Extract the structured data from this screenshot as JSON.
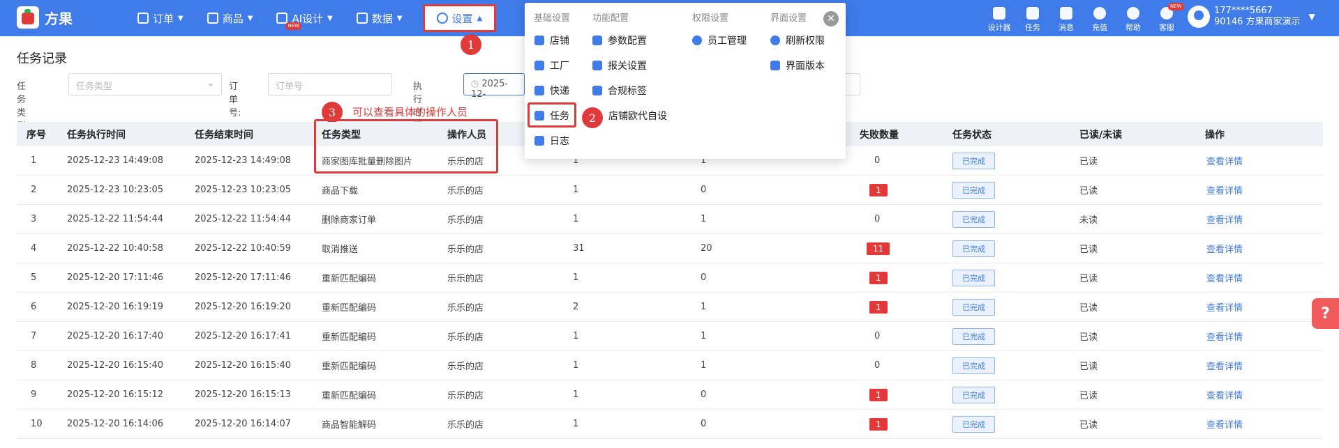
{
  "app": {
    "name": "方果"
  },
  "nav": [
    {
      "label": "订单",
      "icon": "order-icon"
    },
    {
      "label": "商品",
      "icon": "goods-icon"
    },
    {
      "label": "AI设计",
      "icon": "ai-icon",
      "badge": "NEW"
    },
    {
      "label": "数据",
      "icon": "chart-icon"
    },
    {
      "label": "设置",
      "icon": "gear-icon",
      "active": true
    }
  ],
  "tools": [
    {
      "label": "设计器",
      "icon": "designer-icon"
    },
    {
      "label": "任务",
      "icon": "task-icon"
    },
    {
      "label": "消息",
      "icon": "message-icon"
    },
    {
      "label": "充值",
      "icon": "recharge-icon"
    },
    {
      "label": "帮助",
      "icon": "help-icon"
    },
    {
      "label": "客服",
      "icon": "service-icon",
      "badge": "NEW"
    }
  ],
  "user": {
    "phone": "177****5667",
    "account": "90146 方果商家演示"
  },
  "page": {
    "title": "任务记录"
  },
  "filters": {
    "task_type_label": "任务类型:",
    "task_type_placeholder": "任务类型",
    "order_label": "订单号:",
    "order_placeholder": "订单号",
    "time_label": "执行时间:",
    "time_value": "2025-12-"
  },
  "annotations": {
    "n1": "1",
    "n2": "2",
    "n3": "3",
    "n3_text": "可以查看具体的操作人员"
  },
  "dropdown": {
    "headers": [
      "基础设置",
      "功能配置",
      "权限设置",
      "界面设置"
    ],
    "col1": [
      {
        "label": "店铺",
        "icon": "store-icon"
      },
      {
        "label": "工厂",
        "icon": "factory-icon"
      },
      {
        "label": "快递",
        "icon": "express-icon"
      },
      {
        "label": "任务",
        "icon": "task-list-icon"
      },
      {
        "label": "日志",
        "icon": "log-icon"
      }
    ],
    "col2": [
      {
        "label": "参数配置",
        "icon": "params-icon"
      },
      {
        "label": "报关设置",
        "icon": "customs-icon"
      },
      {
        "label": "合规标签",
        "icon": "label-icon"
      },
      {
        "label": "店铺代自设",
        "icon": "",
        "overlap_note": "店铺欧代自设"
      }
    ],
    "col3": [
      {
        "label": "员工管理",
        "icon": "staff-icon"
      }
    ],
    "col4": [
      {
        "label": "刷新权限",
        "icon": "refresh-icon"
      },
      {
        "label": "界面版本",
        "icon": "version-icon"
      }
    ]
  },
  "table": {
    "headers": [
      "序号",
      "任务执行时间",
      "任务结束时间",
      "任务类型",
      "操作人员",
      "失败数量",
      "任务状态",
      "已读/未读",
      "操作"
    ],
    "rows": [
      {
        "no": "1",
        "start": "2025-12-23 14:49:08",
        "end": "2025-12-23 14:49:08",
        "type": "商家图库批量删除图片",
        "operator": "乐乐的店",
        "total": "1",
        "success": "1",
        "fail": "0",
        "status": "已完成",
        "read": "已读",
        "action": "查看详情"
      },
      {
        "no": "2",
        "start": "2025-12-23 10:23:05",
        "end": "2025-12-23 10:23:05",
        "type": "商品下载",
        "operator": "乐乐的店",
        "total": "1",
        "success": "0",
        "fail": "1",
        "status": "已完成",
        "read": "已读",
        "action": "查看详情"
      },
      {
        "no": "3",
        "start": "2025-12-22 11:54:44",
        "end": "2025-12-22 11:54:44",
        "type": "删除商家订单",
        "operator": "乐乐的店",
        "total": "1",
        "success": "1",
        "fail": "0",
        "status": "已完成",
        "read": "未读",
        "action": "查看详情"
      },
      {
        "no": "4",
        "start": "2025-12-22 10:40:58",
        "end": "2025-12-22 10:40:59",
        "type": "取消推送",
        "operator": "乐乐的店",
        "total": "31",
        "success": "20",
        "fail": "11",
        "status": "已完成",
        "read": "已读",
        "action": "查看详情"
      },
      {
        "no": "5",
        "start": "2025-12-20 17:11:46",
        "end": "2025-12-20 17:11:46",
        "type": "重新匹配编码",
        "operator": "乐乐的店",
        "total": "1",
        "success": "0",
        "fail": "1",
        "status": "已完成",
        "read": "已读",
        "action": "查看详情"
      },
      {
        "no": "6",
        "start": "2025-12-20 16:19:19",
        "end": "2025-12-20 16:19:20",
        "type": "重新匹配编码",
        "operator": "乐乐的店",
        "total": "2",
        "success": "1",
        "fail": "1",
        "status": "已完成",
        "read": "已读",
        "action": "查看详情"
      },
      {
        "no": "7",
        "start": "2025-12-20 16:17:40",
        "end": "2025-12-20 16:17:41",
        "type": "重新匹配编码",
        "operator": "乐乐的店",
        "total": "1",
        "success": "1",
        "fail": "0",
        "status": "已完成",
        "read": "已读",
        "action": "查看详情"
      },
      {
        "no": "8",
        "start": "2025-12-20 16:15:40",
        "end": "2025-12-20 16:15:40",
        "type": "重新匹配编码",
        "operator": "乐乐的店",
        "total": "1",
        "success": "1",
        "fail": "0",
        "status": "已完成",
        "read": "已读",
        "action": "查看详情"
      },
      {
        "no": "9",
        "start": "2025-12-20 16:15:12",
        "end": "2025-12-20 16:15:13",
        "type": "重新匹配编码",
        "operator": "乐乐的店",
        "total": "1",
        "success": "0",
        "fail": "1",
        "status": "已完成",
        "read": "已读",
        "action": "查看详情"
      },
      {
        "no": "10",
        "start": "2025-12-20 16:14:06",
        "end": "2025-12-20 16:14:07",
        "type": "商品智能解码",
        "operator": "乐乐的店",
        "total": "1",
        "success": "0",
        "fail": "1",
        "status": "已完成",
        "read": "已读",
        "action": "查看详情"
      }
    ]
  },
  "colors": {
    "primary": "#3f7be9",
    "danger": "#e23a3a"
  }
}
